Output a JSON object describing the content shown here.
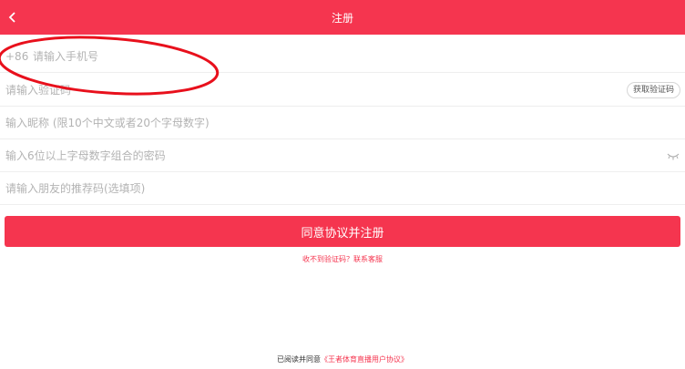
{
  "header": {
    "title": "注册",
    "back_icon": "chevron-left-icon",
    "color": "#f5354f"
  },
  "form": {
    "country_code": "+86",
    "phone_placeholder": "请输入手机号",
    "code_placeholder": "请输入验证码",
    "get_code_label": "获取验证码",
    "nickname_placeholder": "输入昵称 (限10个中文或者20个字母数字)",
    "password_placeholder": "输入6位以上字母数字组合的密码",
    "password_toggle_icon": "eye-closed-icon",
    "referral_placeholder": "请输入朋友的推荐码(选填项)"
  },
  "submit_label": "同意协议并注册",
  "help_text": "收不到验证码？联系客服",
  "agreement": {
    "prefix": "已阅读并同意",
    "link": "《王者体育直播用户协议》"
  },
  "annotation": {
    "shape": "ellipse",
    "color": "#e8101c"
  }
}
